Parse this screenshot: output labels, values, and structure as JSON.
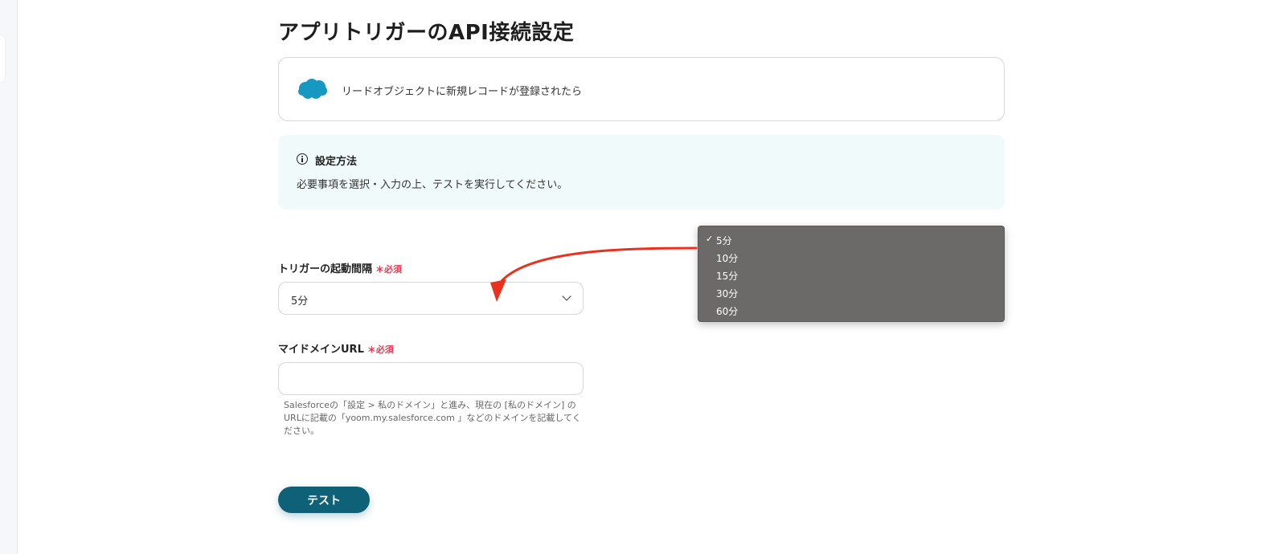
{
  "page": {
    "crumb": "",
    "title": "アプリトリガーのAPI接続設定"
  },
  "trigger": {
    "app_icon": "salesforce-logo",
    "label": "リードオブジェクトに新規レコードが登録されたら"
  },
  "info": {
    "icon": "info-icon",
    "title": "設定方法",
    "text": "必要事項を選択・入力の上、テストを実行してください。"
  },
  "interval_field": {
    "label": "トリガーの起動間隔",
    "required": "＊必須",
    "value": "5分",
    "options": [
      "5分",
      "10分",
      "15分",
      "30分",
      "60分"
    ],
    "selected_index": 0
  },
  "domain_field": {
    "label": "マイドメインURL",
    "required": "＊必須",
    "value": "",
    "placeholder": "",
    "help_text": "Salesforceの「設定 > 私のドメイン」と進み、現在の [私のドメイン] のURLに記載の「yoom.my.salesforce.com 」などのドメインを記載してください。"
  },
  "actions": {
    "test_label": "テスト"
  },
  "colors": {
    "accent": "#0f6178",
    "required": "#e8384f",
    "info_bg": "#f1fafa",
    "salesforce": "#1798c1",
    "annotation_arrow": "#e8321e"
  }
}
